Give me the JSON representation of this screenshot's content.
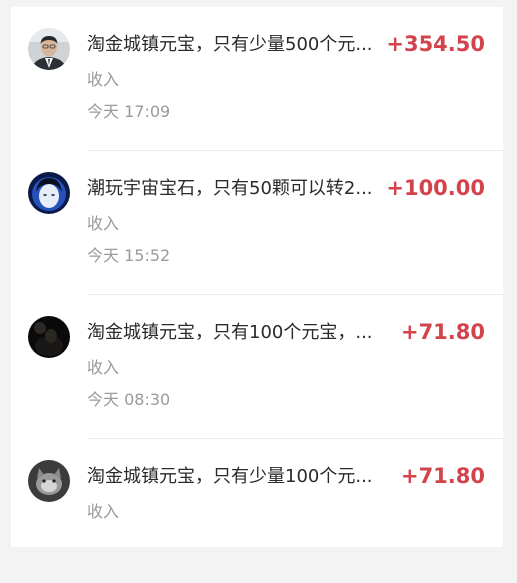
{
  "transactions": [
    {
      "title": "淘金城镇元宝，只有少量500个元...",
      "amount": "+354.50",
      "type": "收入",
      "time": "今天 17:09",
      "avatar": "man-in-suit-avatar"
    },
    {
      "title": "潮玩宇宙宝石，只有50颗可以转2...",
      "amount": "+100.00",
      "type": "收入",
      "time": "今天 15:52",
      "avatar": "blue-light-face-avatar"
    },
    {
      "title": "淘金城镇元宝，只有100个元宝，...",
      "amount": "+71.80",
      "type": "收入",
      "time": "今天 08:30",
      "avatar": "dark-silhouette-avatar"
    },
    {
      "title": "淘金城镇元宝，只有少量100个元...",
      "amount": "+71.80",
      "type": "收入",
      "avatar": "grey-cat-avatar"
    }
  ],
  "colors": {
    "amount": "#d2434b",
    "secondary_text": "#9a9a9a",
    "primary_text": "#2a2a2a"
  }
}
